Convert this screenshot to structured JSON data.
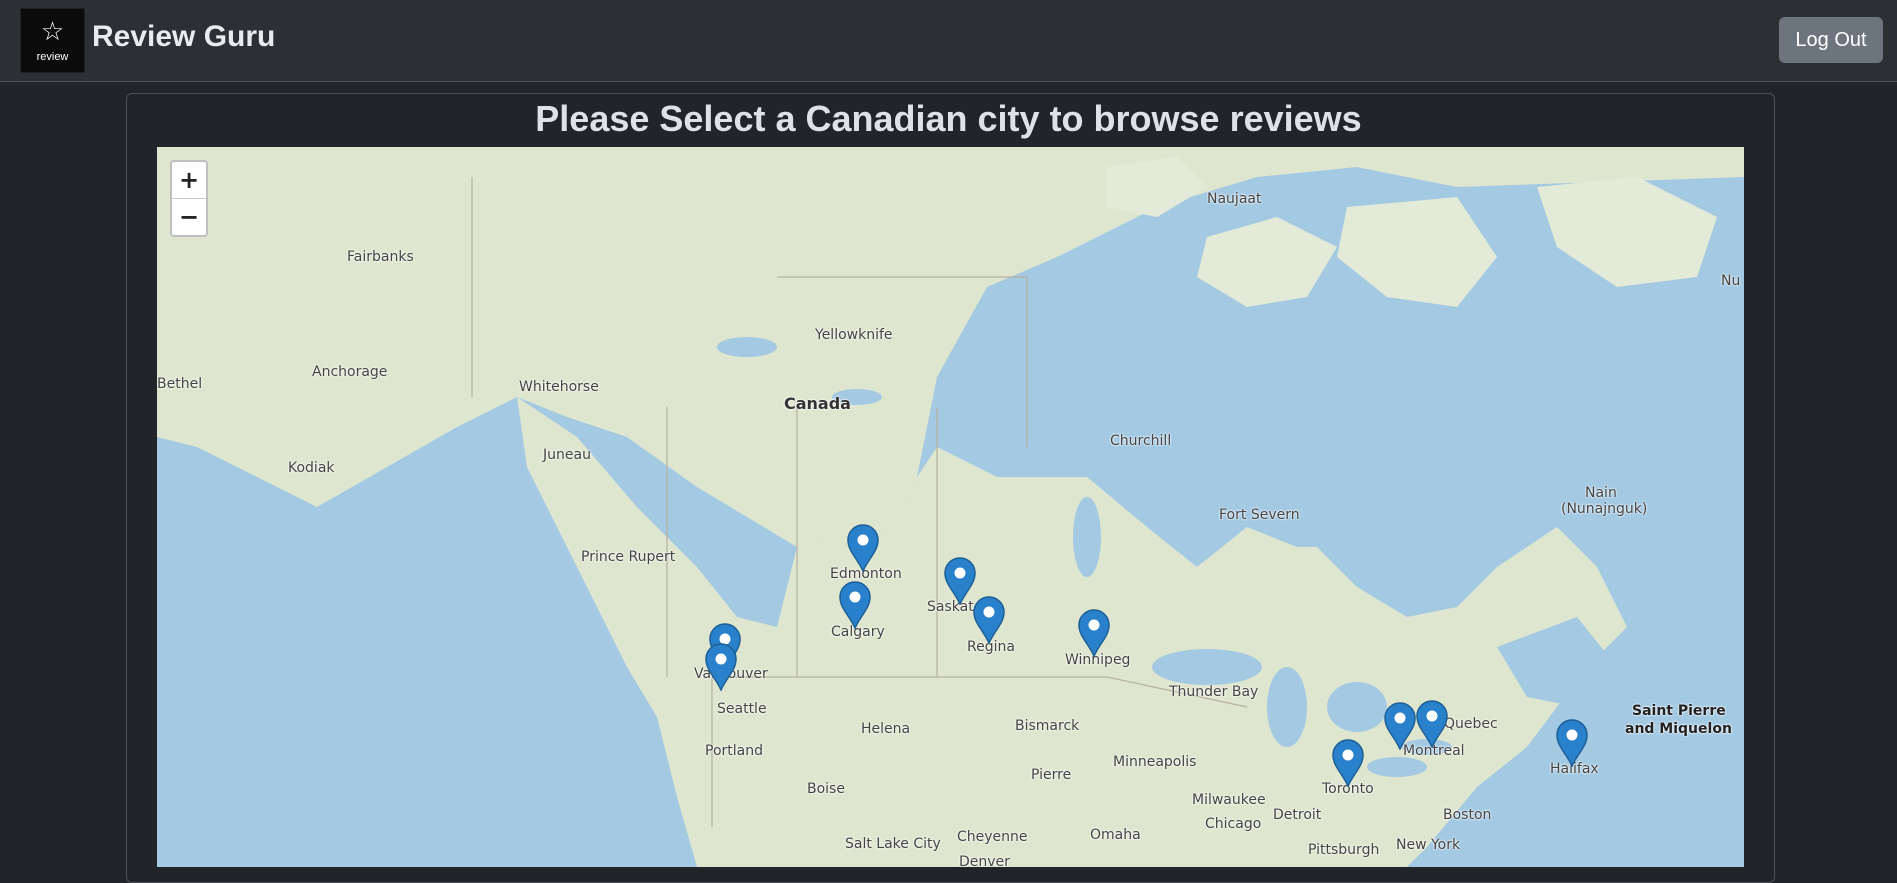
{
  "app": {
    "logo_text": "review",
    "brand": "Review Guru",
    "logout_label": "Log Out"
  },
  "page": {
    "title": "Please Select a Canadian city to browse reviews"
  },
  "map": {
    "zoom_in": "+",
    "zoom_out": "−",
    "labels": [
      {
        "text": "Naujaat"
      },
      {
        "text": "Fairbanks"
      },
      {
        "text": "Nu"
      },
      {
        "text": "Yellowknife"
      },
      {
        "text": "Anchorage"
      },
      {
        "text": "Bethel"
      },
      {
        "text": "Whitehorse"
      },
      {
        "text": "Canada"
      },
      {
        "text": "Churchill"
      },
      {
        "text": "Kodiak"
      },
      {
        "text": "Juneau"
      },
      {
        "text": "Nain"
      },
      {
        "text": "(Nunajnguk)"
      },
      {
        "text": "Fort Severn"
      },
      {
        "text": "Prince Rupert"
      },
      {
        "text": "Edmonton"
      },
      {
        "text": "Saskatoon"
      },
      {
        "text": "Calgary"
      },
      {
        "text": "Regina"
      },
      {
        "text": "Winnipeg"
      },
      {
        "text": "Vancouver"
      },
      {
        "text": "Thunder Bay"
      },
      {
        "text": "Seattle"
      },
      {
        "text": "Saint Pierre"
      },
      {
        "text": "and Miquelon"
      },
      {
        "text": "Helena"
      },
      {
        "text": "Bismarck"
      },
      {
        "text": "Quebec"
      },
      {
        "text": "Portland"
      },
      {
        "text": "Minneapolis"
      },
      {
        "text": "Montreal"
      },
      {
        "text": "Halifax"
      },
      {
        "text": "Pierre"
      },
      {
        "text": "Boise"
      },
      {
        "text": "Toronto"
      },
      {
        "text": "Milwaukee"
      },
      {
        "text": "Detroit"
      },
      {
        "text": "Boston"
      },
      {
        "text": "Chicago"
      },
      {
        "text": "Salt Lake City"
      },
      {
        "text": "Cheyenne"
      },
      {
        "text": "Omaha"
      },
      {
        "text": "New York"
      },
      {
        "text": "Pittsburgh"
      },
      {
        "text": "Denver"
      }
    ],
    "markers": [
      {
        "city": "Edmonton"
      },
      {
        "city": "Calgary"
      },
      {
        "city": "Saskatoon"
      },
      {
        "city": "Regina"
      },
      {
        "city": "Winnipeg"
      },
      {
        "city": "Vancouver"
      },
      {
        "city": "Victoria"
      },
      {
        "city": "Toronto"
      },
      {
        "city": "Ottawa"
      },
      {
        "city": "Montreal"
      },
      {
        "city": "Halifax"
      }
    ],
    "colors": {
      "water": "#a3c9e3",
      "land": "#dfe6cf",
      "marker": "#2a81cb"
    }
  }
}
